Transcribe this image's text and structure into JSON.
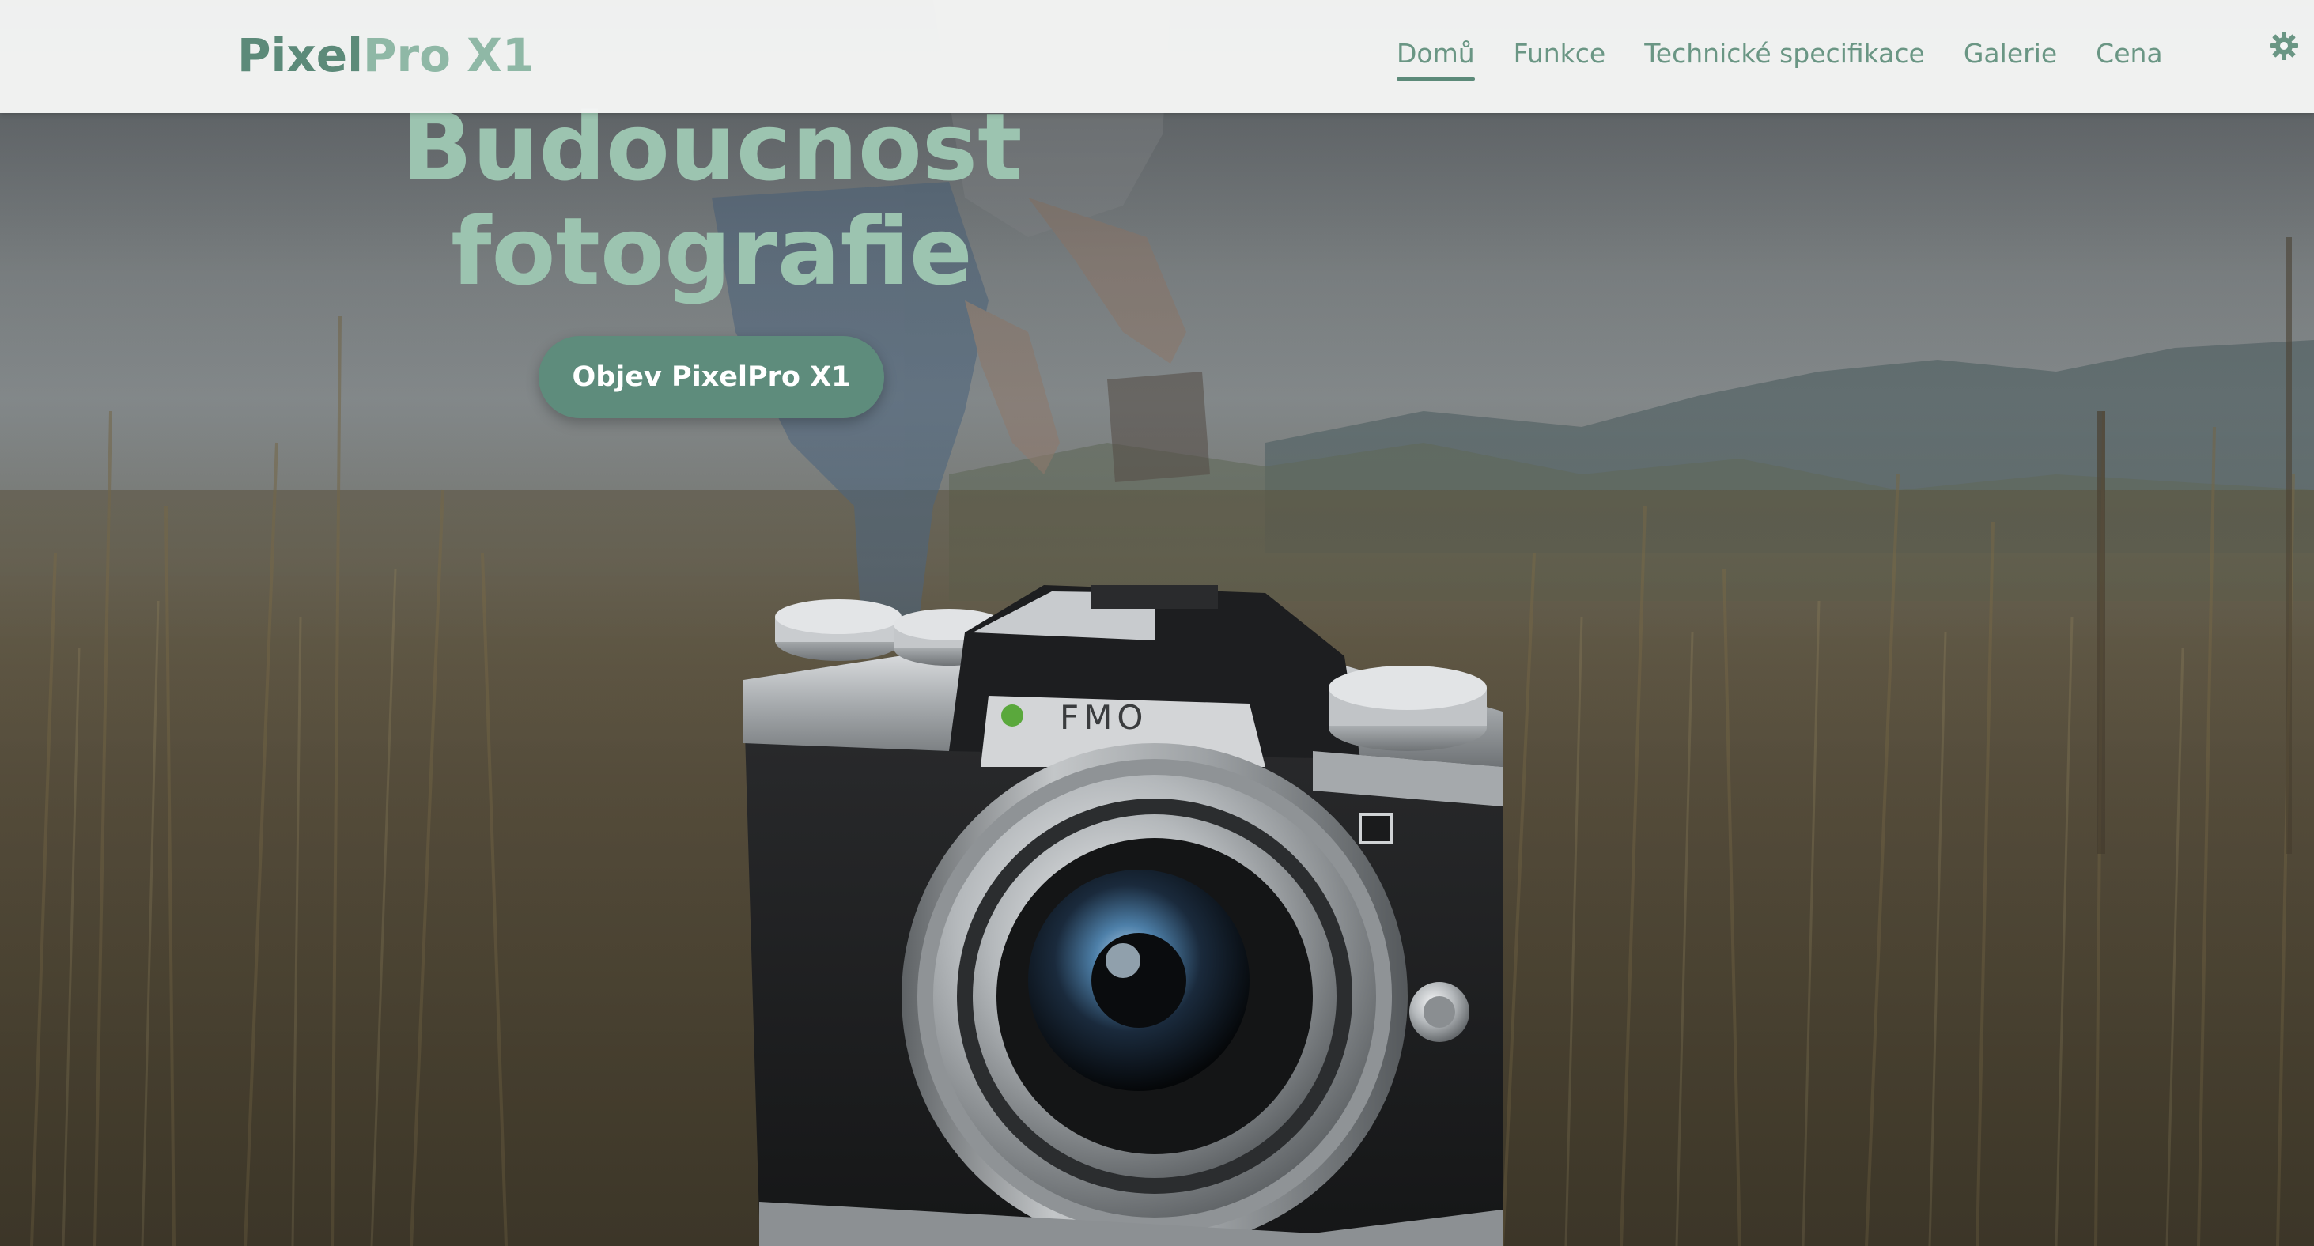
{
  "navbar": {
    "logo_part1": "Pixel",
    "logo_part2": "Pro X1",
    "items": [
      {
        "label": "Domů",
        "active": true
      },
      {
        "label": "Funkce",
        "active": false
      },
      {
        "label": "Technické specifikace",
        "active": false
      },
      {
        "label": "Galerie",
        "active": false
      },
      {
        "label": "Cena",
        "active": false
      }
    ],
    "theme_icon": "gear-icon"
  },
  "hero": {
    "title_line1": "Budoucnost",
    "title_line2": "fotografie",
    "cta_label": "Objev PixelPro X1",
    "camera_brand": "FMO"
  },
  "colors": {
    "accent": "#5e8c7c",
    "accent_light": "#9cc4b0",
    "nav_text": "#6a9684",
    "navbar_bg": "#f5f6f5"
  }
}
